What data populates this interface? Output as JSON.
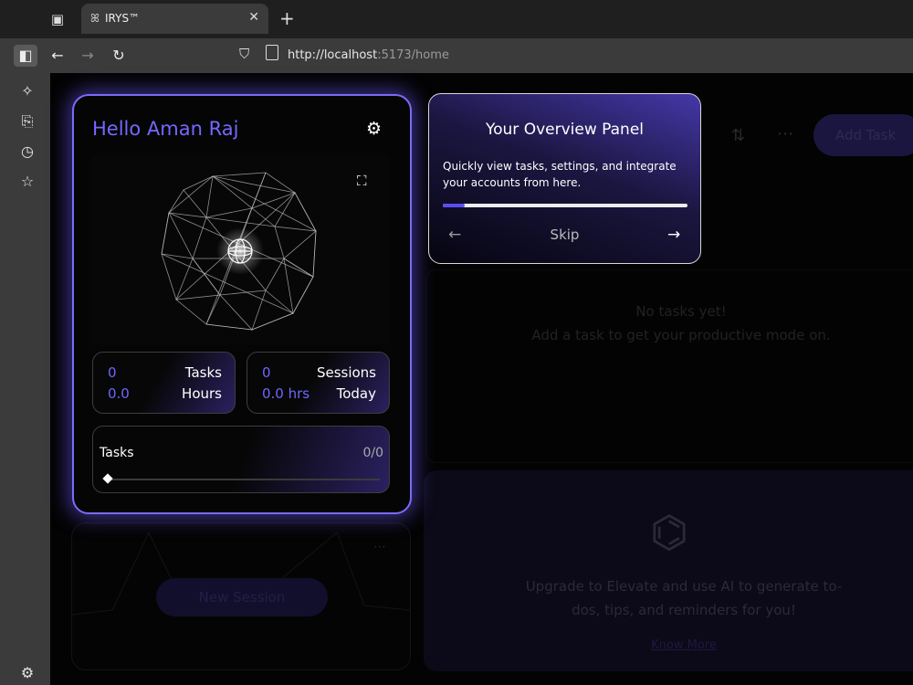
{
  "browser": {
    "tab_title": "IRYS™",
    "tab_favicon": "ꕤ",
    "new_tab": "+",
    "close_tab": "✕",
    "url_host": "http://localhost",
    "url_path": ":5173/home"
  },
  "background": {
    "add_task": "Add Task",
    "empty_line1": "No tasks yet!",
    "empty_line2": "Add a task to get your productive mode on.",
    "upgrade_line1": "Upgrade to Elevate and use AI to generate to-",
    "upgrade_line2": "dos, tips, and reminders for you!",
    "know_more": "Know More",
    "new_session": "New Session"
  },
  "profile": {
    "greeting": "Hello Aman Raj",
    "stats": {
      "tasks_count": "0",
      "tasks_label": "Tasks",
      "hours_value": "0.0",
      "hours_label": "Hours",
      "sessions_count": "0",
      "sessions_label": "Sessions",
      "today_value": "0.0 hrs",
      "today_label": "Today"
    },
    "progress": {
      "label": "Tasks",
      "count": "0/0",
      "fraction": 0
    }
  },
  "overview": {
    "title": "Your Overview Panel",
    "description": "Quickly view tasks, settings, and integrate your accounts from here.",
    "skip": "Skip",
    "step_progress_percent": 9
  },
  "colors": {
    "accent": "#7468ff",
    "card_border": "#7a6cf5"
  },
  "icons": [
    "tab-manager-icon",
    "sidebar-toggle-icon",
    "back-arrow-icon",
    "forward-arrow-icon",
    "reload-icon",
    "shield-icon",
    "page-icon",
    "sparkle-icon",
    "save-icon",
    "history-icon",
    "star-icon",
    "settings-icon",
    "gear-icon",
    "expand-icon",
    "arrow-left-icon",
    "arrow-right-icon"
  ]
}
